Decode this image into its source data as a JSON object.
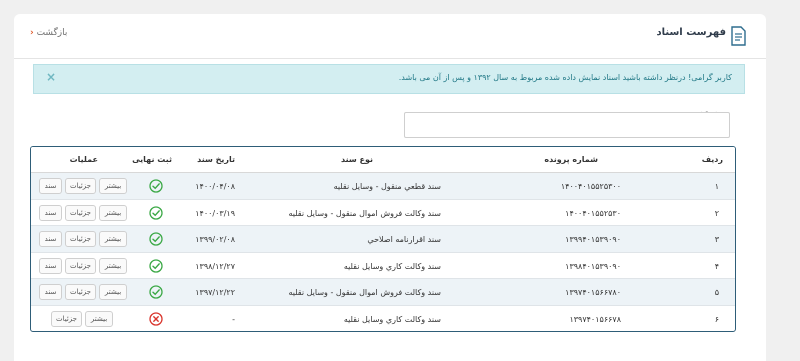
{
  "header": {
    "title": "فهرست اسناد",
    "back_label": "بازگشت"
  },
  "alert": {
    "text": "کاربر گرامی! درنظر داشته باشید اسناد نمایش داده شده مربوط به سال ۱۳۹۲ و پس از آن می باشد.",
    "close": "×"
  },
  "search": {
    "label": "جستجو",
    "value": ""
  },
  "table": {
    "columns": {
      "index": "ردیف",
      "case_number": "شماره پرونده",
      "doc_type": "نوع سند",
      "doc_date": "تاریخ سند",
      "final_registration": "ثبت نهایی",
      "operations": "عملیات"
    },
    "rows": [
      {
        "index": "۱",
        "case_number": "۱۴۰۰۴۰۱۵۵۲۵۳۰۰",
        "doc_type": "سند قطعي منقول - وسایل نقلیه",
        "doc_date": "۱۴۰۰/۰۴/۰۸",
        "final": "registered",
        "buttons": [
          "بیشتر",
          "جزئیات",
          "سند"
        ]
      },
      {
        "index": "۲",
        "case_number": "۱۴۰۰۴۰۱۵۵۲۵۳۰",
        "doc_type": "سند وكالت فروش اموال منقول - وسایل نقلیه",
        "doc_date": "۱۴۰۰/۰۳/۱۹",
        "final": "registered",
        "buttons": [
          "بیشتر",
          "جزئیات",
          "سند"
        ]
      },
      {
        "index": "۳",
        "case_number": "۱۳۹۹۴۰۱۵۳۹۰۹۰",
        "doc_type": "سند اقرارنامه اصلاحي",
        "doc_date": "۱۳۹۹/۰۲/۰۸",
        "final": "registered",
        "buttons": [
          "بیشتر",
          "جزئیات",
          "سند"
        ]
      },
      {
        "index": "۴",
        "case_number": "۱۳۹۸۴۰۱۵۳۹۰۹۰",
        "doc_type": "سند وكالت كاري وسايل نقليه",
        "doc_date": "۱۳۹۸/۱۲/۲۷",
        "final": "registered",
        "buttons": [
          "بیشتر",
          "جزئیات",
          "سند"
        ]
      },
      {
        "index": "۵",
        "case_number": "۱۳۹۷۴۰۱۵۶۶۷۸۰",
        "doc_type": "سند وكالت فروش اموال منقول - وسایل نقلیه",
        "doc_date": "۱۳۹۷/۱۲/۲۲",
        "final": "registered",
        "buttons": [
          "بیشتر",
          "جزئیات",
          "سند"
        ]
      },
      {
        "index": "۶",
        "case_number": "۱۳۹۷۴۰۱۵۶۶۷۸",
        "doc_type": "سند وكالت كاري وسايل نقليه",
        "doc_date": "-",
        "final": "not-registered",
        "buttons": [
          "بیشتر",
          "جزئیات"
        ]
      }
    ]
  },
  "colors": {
    "accent": "#e05a2b",
    "alert_bg": "#d3eef1",
    "alert_text": "#1f7785",
    "table_border": "#2e5d78",
    "success": "#3aa845",
    "danger": "#d9342b"
  },
  "icons": {
    "header": "document-icon",
    "registered": "check-circle-icon",
    "not_registered": "x-circle-icon"
  }
}
